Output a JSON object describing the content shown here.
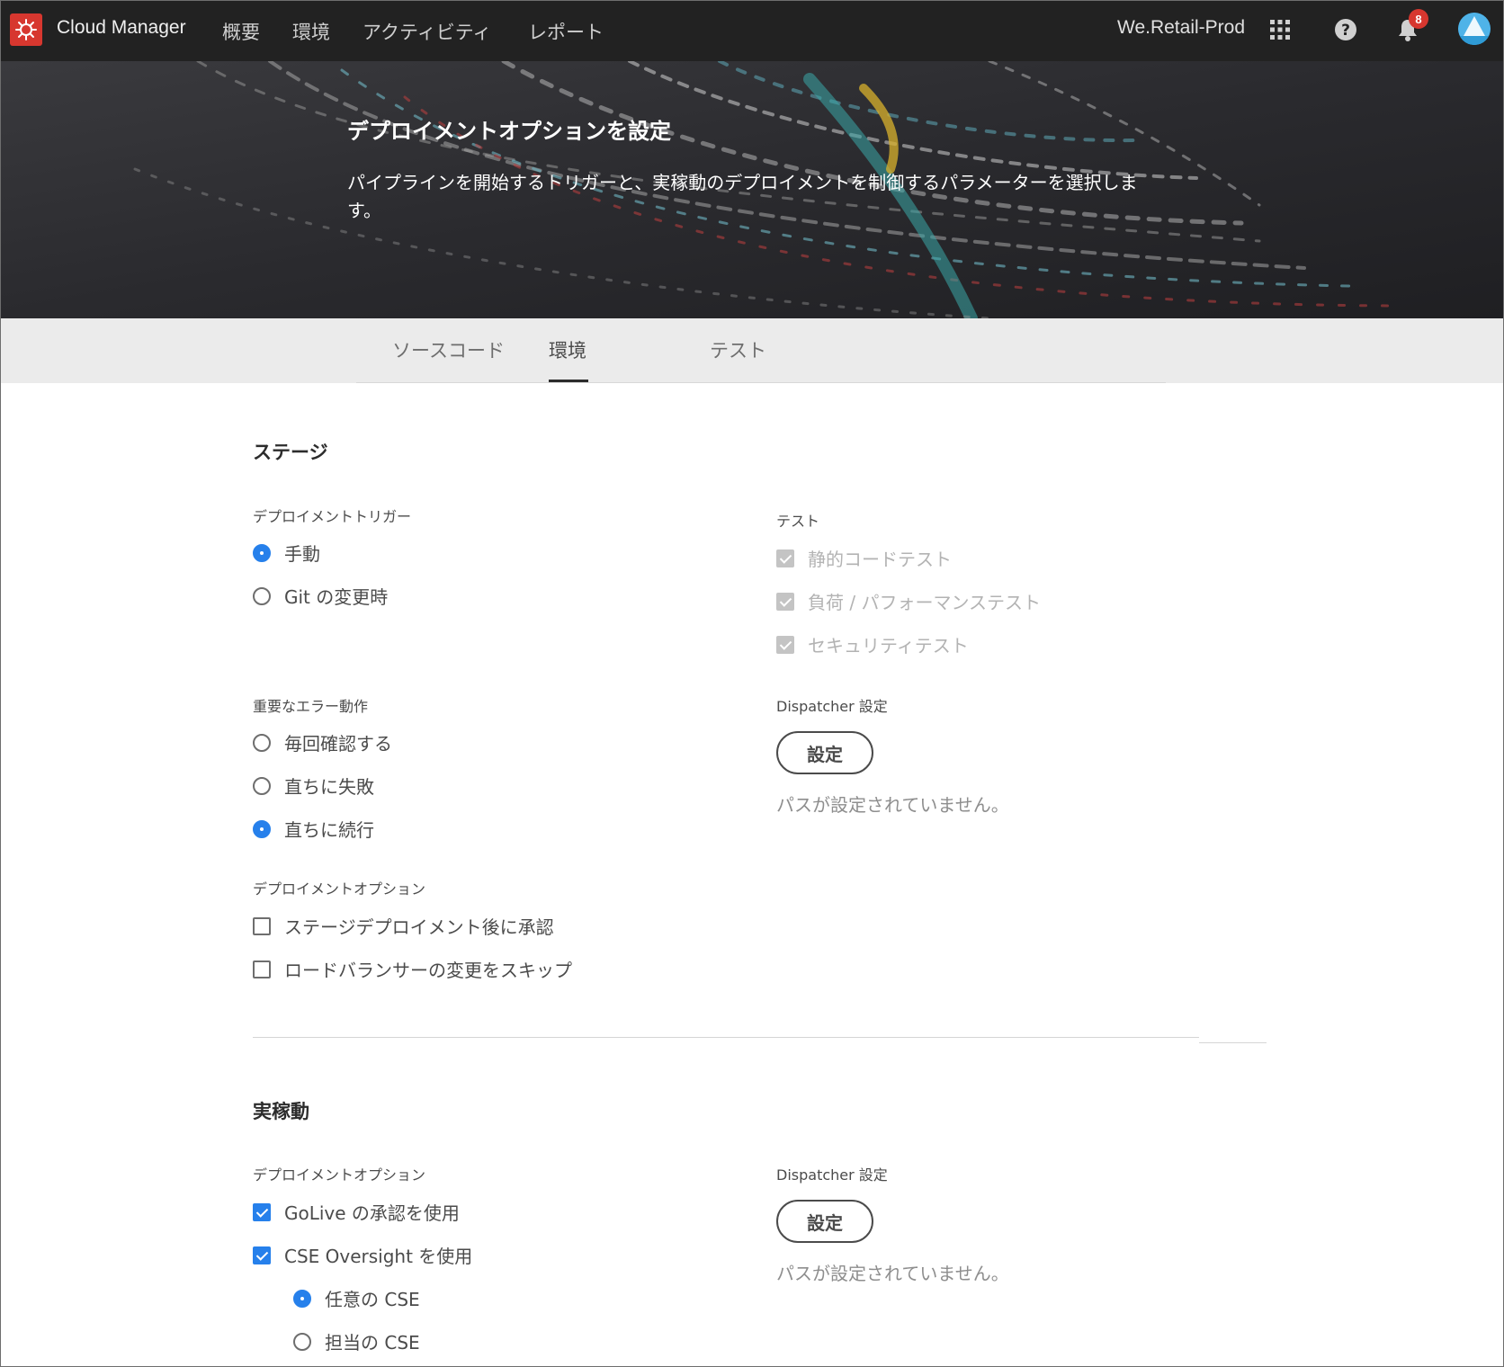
{
  "topbar": {
    "brand": "Cloud Manager",
    "nav": [
      "概要",
      "環境",
      "アクティビティ",
      "レポート"
    ],
    "org": "We.Retail-Prod",
    "notification_count": "8",
    "icons": [
      "adobe-logo-icon",
      "apps-grid-icon",
      "help-icon",
      "bell-icon",
      "avatar"
    ]
  },
  "hero": {
    "title": "デプロイメントオプションを設定",
    "description": "パイプラインを開始するトリガーと、実稼動のデプロイメントを制御するパラメーターを選択します。"
  },
  "tabs": [
    {
      "label": "ソースコード",
      "active": false
    },
    {
      "label": "環境",
      "active": true
    },
    {
      "label": "テスト",
      "active": false
    }
  ],
  "stage": {
    "title": "ステージ",
    "trigger": {
      "label": "デプロイメントトリガー",
      "options": [
        {
          "label": "手動",
          "selected": true
        },
        {
          "label": "Git の変更時",
          "selected": false
        }
      ]
    },
    "error": {
      "label": "重要なエラー動作",
      "options": [
        {
          "label": "毎回確認する",
          "selected": false
        },
        {
          "label": "直ちに失敗",
          "selected": false
        },
        {
          "label": "直ちに続行",
          "selected": true
        }
      ]
    },
    "deploy_options": {
      "label": "デプロイメントオプション",
      "options": [
        {
          "label": "ステージデプロイメント後に承認",
          "checked": false
        },
        {
          "label": "ロードバランサーの変更をスキップ",
          "checked": false
        }
      ]
    },
    "tests": {
      "label": "テスト",
      "options": [
        {
          "label": "静的コードテスト",
          "checked": true,
          "disabled": true
        },
        {
          "label": "負荷 / パフォーマンステスト",
          "checked": true,
          "disabled": true
        },
        {
          "label": "セキュリティテスト",
          "checked": true,
          "disabled": true
        }
      ]
    },
    "dispatcher": {
      "label": "Dispatcher 設定",
      "button": "設定",
      "note": "パスが設定されていません。"
    }
  },
  "prod": {
    "title": "実稼動",
    "deploy_options": {
      "label": "デプロイメントオプション",
      "options": [
        {
          "label": "GoLive の承認を使用",
          "checked": true
        },
        {
          "label": "CSE Oversight を使用",
          "checked": true
        }
      ],
      "cse": [
        {
          "label": "任意の CSE",
          "selected": true
        },
        {
          "label": "担当の CSE",
          "selected": false
        }
      ]
    },
    "dispatcher": {
      "label": "Dispatcher 設定",
      "button": "設定",
      "note": "パスが設定されていません。"
    }
  },
  "colors": {
    "accent": "#2680eb",
    "topbar": "#222222",
    "brand_red": "#d7372f",
    "tab_strip": "#ebebeb"
  }
}
